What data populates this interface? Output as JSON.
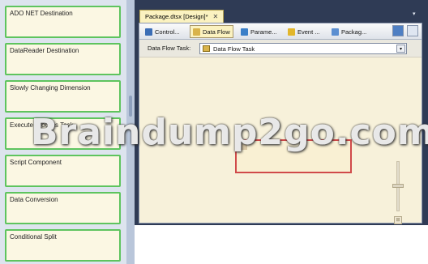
{
  "toolbox": {
    "items": [
      {
        "label": "ADO NET Destination"
      },
      {
        "label": "DataReader Destination"
      },
      {
        "label": "Slowly Changing Dimension"
      },
      {
        "label": "Execute Process Task"
      },
      {
        "label": "Script Component"
      },
      {
        "label": "Data Conversion"
      },
      {
        "label": "Conditional Split"
      }
    ]
  },
  "document": {
    "tab_title": "Package.dtsx [Design]*",
    "close_glyph": "✕",
    "dropdown_glyph": "▾"
  },
  "designer": {
    "tabs": [
      {
        "label": "Control...",
        "icon": "control-flow-icon",
        "color": "#3b6db5"
      },
      {
        "label": "Data Flow",
        "icon": "data-flow-icon",
        "color": "#d9b34a"
      },
      {
        "label": "Parame...",
        "icon": "parameters-icon",
        "color": "#3b7fc8"
      },
      {
        "label": "Event ...",
        "icon": "event-handlers-icon",
        "color": "#e2b62b"
      },
      {
        "label": "Packag...",
        "icon": "package-explorer-icon",
        "color": "#5c8fd1"
      }
    ],
    "data_flow_task_label": "Data Flow Task:",
    "data_flow_task_value": "Data Flow Task",
    "combo_arrow": "▾",
    "zoom_fit_glyph": "⊞"
  },
  "watermark": "Braindump2go.com",
  "colors": {
    "tool_border": "#5ec45e",
    "tool_background": "#fbf7e3",
    "selection_border": "#d04a4a",
    "frame": "#2f3b55"
  }
}
